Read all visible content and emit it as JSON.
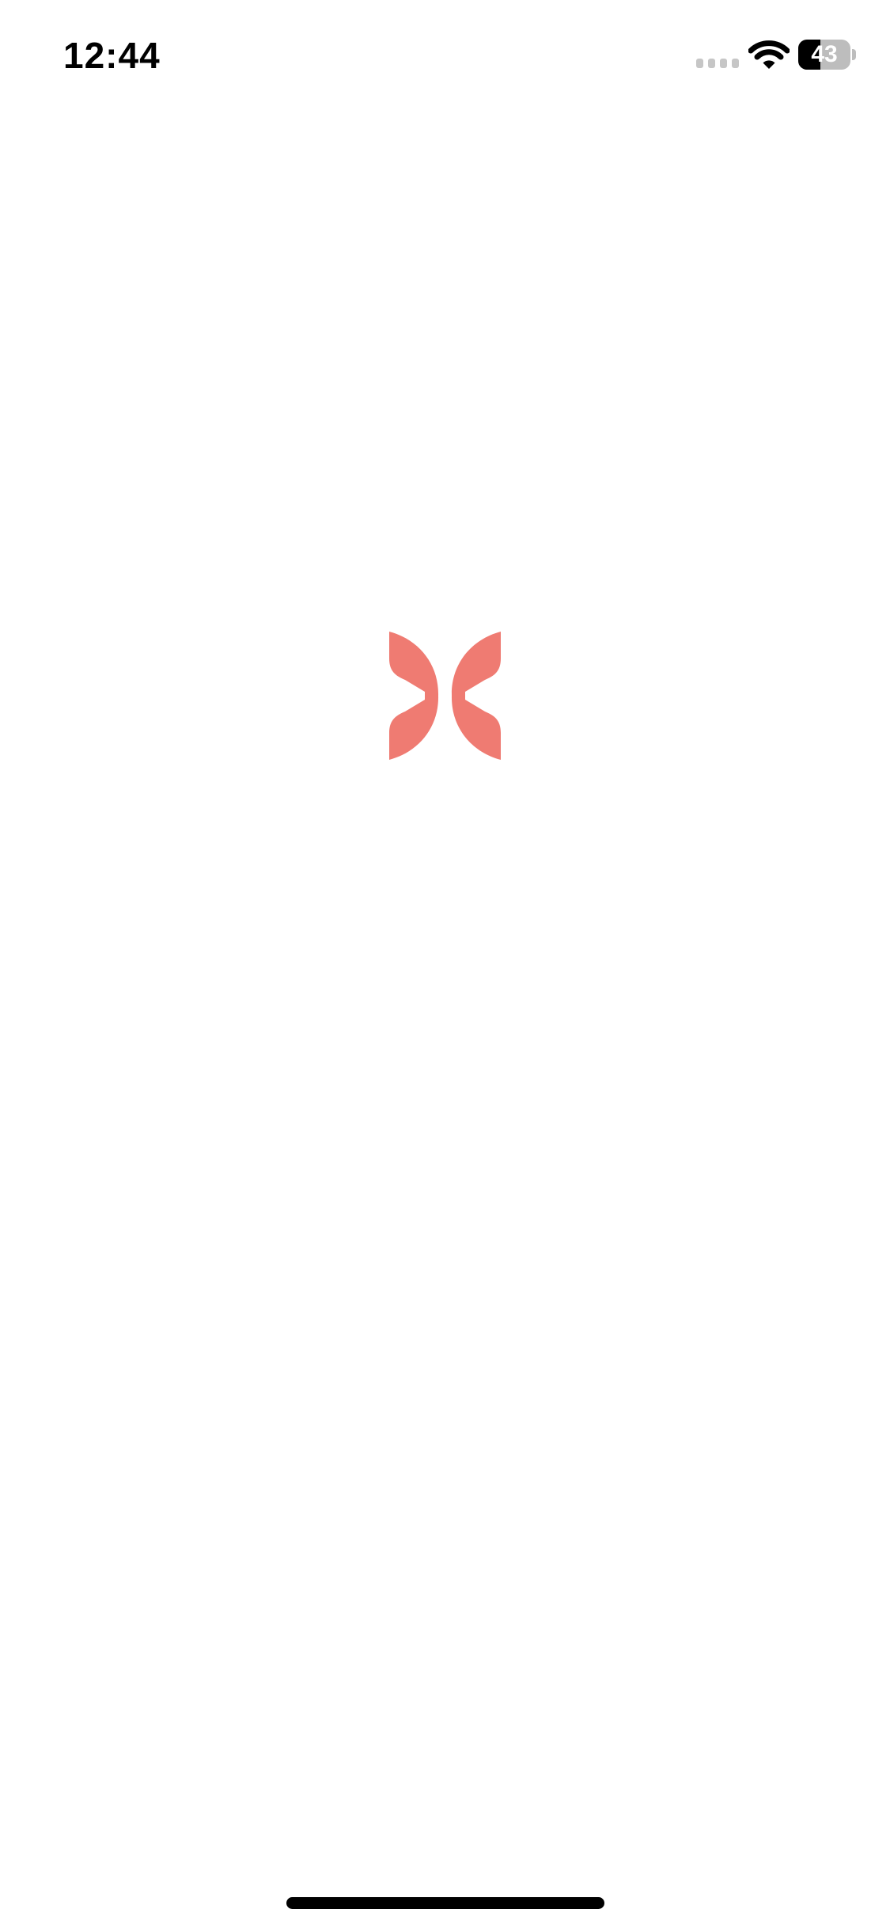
{
  "status_bar": {
    "time": "12:44",
    "battery_level": "43",
    "battery_fraction": 0.43,
    "signal_icon": "cellular-signal-icon",
    "wifi_icon": "wifi-icon",
    "battery_icon": "battery-icon"
  },
  "splash": {
    "logo_icon": "butterfly-logo-icon",
    "logo_color": "#ef7b72"
  },
  "colors": {
    "background": "#ffffff",
    "text": "#000000",
    "inactive_signal": "#c6c6c6",
    "battery_track": "#bdbdbd"
  }
}
